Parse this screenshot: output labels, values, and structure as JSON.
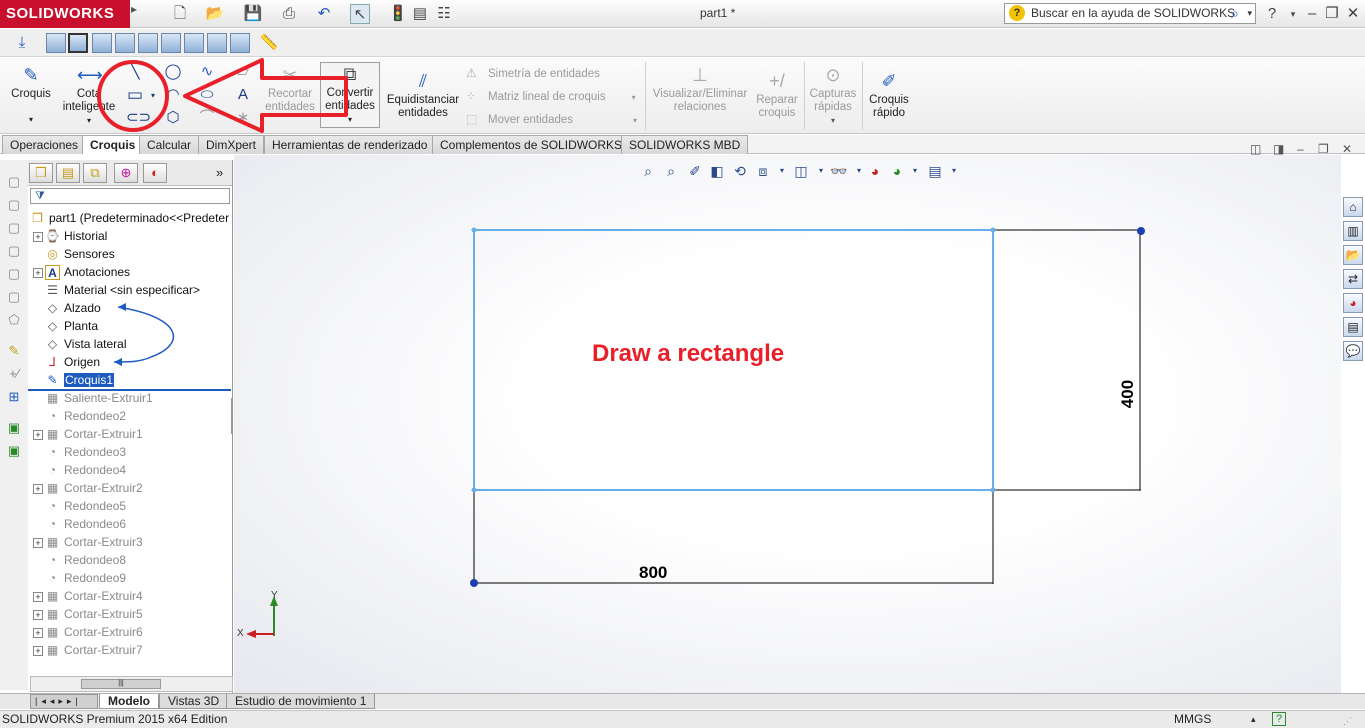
{
  "titlebar": {
    "brand": "SOLIDWORKS",
    "doc_title": "part1 *",
    "search_placeholder": "Buscar en la ayuda de SOLIDWORKS"
  },
  "command_manager": {
    "croquis": "Croquis",
    "cota_1": "Cota",
    "cota_2": "inteligente",
    "recortar_1": "Recortar",
    "recortar_2": "entidades",
    "convertir_1": "Convertir",
    "convertir_2": "entidades",
    "equid_1": "Equidistanciar",
    "equid_2": "entidades",
    "simetria": "Simetría de entidades",
    "matriz": "Matriz lineal de croquis",
    "mover": "Mover entidades",
    "visualizar_1": "Visualizar/Eliminar",
    "visualizar_2": "relaciones",
    "reparar_1": "Reparar",
    "reparar_2": "croquis",
    "capturas_1": "Capturas",
    "capturas_2": "rápidas",
    "rapido_1": "Croquis",
    "rapido_2": "rápido"
  },
  "tabs": [
    "Operaciones",
    "Croquis",
    "Calcular",
    "DimXpert",
    "Herramientas de renderizado",
    "Complementos de SOLIDWORKS",
    "SOLIDWORKS MBD"
  ],
  "feature_tree": {
    "root": "part1  (Predeterminado<<Predeter",
    "items": [
      {
        "label": "Historial"
      },
      {
        "label": "Sensores"
      },
      {
        "label": "Anotaciones"
      },
      {
        "label": "Material <sin especificar>"
      },
      {
        "label": "Alzado"
      },
      {
        "label": "Planta"
      },
      {
        "label": "Vista lateral"
      },
      {
        "label": "Origen"
      },
      {
        "label": "Croquis1"
      },
      {
        "label": "Saliente-Extruir1"
      },
      {
        "label": "Redondeo2"
      },
      {
        "label": "Cortar-Extruir1"
      },
      {
        "label": "Redondeo3"
      },
      {
        "label": "Redondeo4"
      },
      {
        "label": "Cortar-Extruir2"
      },
      {
        "label": "Redondeo5"
      },
      {
        "label": "Redondeo6"
      },
      {
        "label": "Cortar-Extruir3"
      },
      {
        "label": "Redondeo8"
      },
      {
        "label": "Redondeo9"
      },
      {
        "label": "Cortar-Extruir4"
      },
      {
        "label": "Cortar-Extruir5"
      },
      {
        "label": "Cortar-Extruir6"
      },
      {
        "label": "Cortar-Extruir7"
      }
    ]
  },
  "canvas": {
    "instruction": "Draw a rectangle",
    "dim_width": "800",
    "dim_height": "400",
    "axis_x": "X",
    "axis_y": "Y"
  },
  "bottom_tabs": [
    "Modelo",
    "Vistas 3D",
    "Estudio de movimiento 1"
  ],
  "status": {
    "left": "SOLIDWORKS Premium 2015 x64 Edition",
    "units": "MMGS"
  },
  "colors": {
    "annotation_red": "#e8202a",
    "sketch_blue": "#6aaee8",
    "selection_blue": "#1d5bbf"
  }
}
